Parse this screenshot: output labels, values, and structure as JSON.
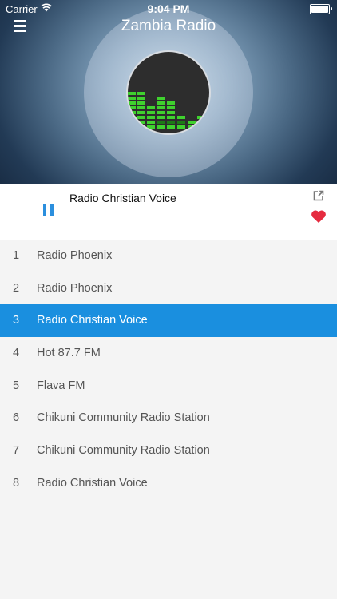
{
  "status_bar": {
    "carrier": "Carrier",
    "time": "9:04 PM"
  },
  "header": {
    "title": "Zambia Radio",
    "menu_icon": "hamburger-menu-icon"
  },
  "now_playing": {
    "station": "Radio Christian Voice",
    "state": "playing",
    "favorite": true,
    "accent_color": "#2b8fde",
    "heart_color": "#e52b3f"
  },
  "stations": [
    {
      "number": "1",
      "name": "Radio Phoenix"
    },
    {
      "number": "2",
      "name": "Radio Phoenix"
    },
    {
      "number": "3",
      "name": "Radio Christian Voice",
      "active": true
    },
    {
      "number": "4",
      "name": "Hot 87.7 FM"
    },
    {
      "number": "5",
      "name": "Flava FM"
    },
    {
      "number": "6",
      "name": "Chikuni Community Radio Station"
    },
    {
      "number": "7",
      "name": "Chikuni Community Radio Station"
    },
    {
      "number": "8",
      "name": "Radio Christian Voice"
    }
  ],
  "colors": {
    "active_row": "#1a8fdf",
    "list_background": "#f4f4f4"
  }
}
